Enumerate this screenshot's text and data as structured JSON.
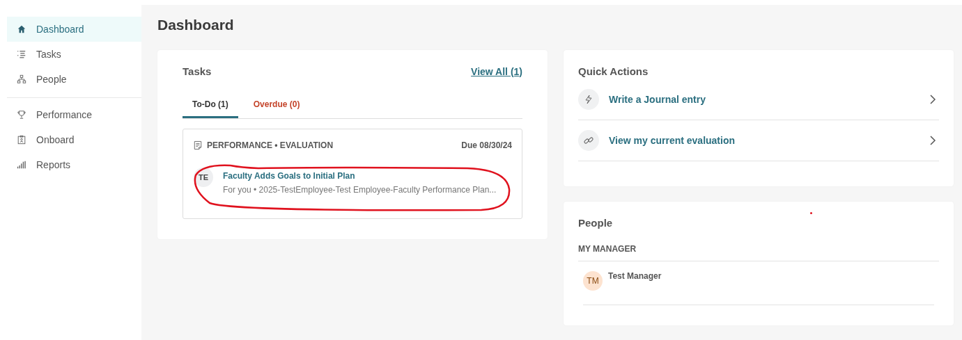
{
  "sidebar": {
    "groups": [
      {
        "items": [
          {
            "label": "Dashboard",
            "selected": true
          },
          {
            "label": "Tasks",
            "selected": false
          },
          {
            "label": "People",
            "selected": false
          }
        ]
      },
      {
        "items": [
          {
            "label": "Performance",
            "selected": false
          },
          {
            "label": "Onboard",
            "selected": false
          },
          {
            "label": "Reports",
            "selected": false
          }
        ]
      }
    ]
  },
  "page_title": "Dashboard",
  "tasks_card": {
    "title": "Tasks",
    "view_all": "View All (1)",
    "tabs": [
      {
        "label": "To-Do (1)",
        "selected": true,
        "kind": "normal"
      },
      {
        "label": "Overdue (0)",
        "selected": false,
        "kind": "alert"
      }
    ],
    "task": {
      "category": "PERFORMANCE • EVALUATION",
      "due": "Due 08/30/24",
      "initials": "TE",
      "title": "Faculty Adds Goals to Initial Plan",
      "subtitle": "For you • 2025-TestEmployee-Test Employee-Faculty Performance Plan..."
    }
  },
  "quick_actions": {
    "title": "Quick Actions",
    "items": [
      {
        "label": "Write a Journal entry",
        "kind": "bolt"
      },
      {
        "label": "View my current evaluation",
        "kind": "link"
      }
    ]
  },
  "people_card": {
    "title": "People",
    "section": "MY MANAGER",
    "people": [
      {
        "initials": "TM",
        "name": "Test Manager"
      }
    ]
  }
}
